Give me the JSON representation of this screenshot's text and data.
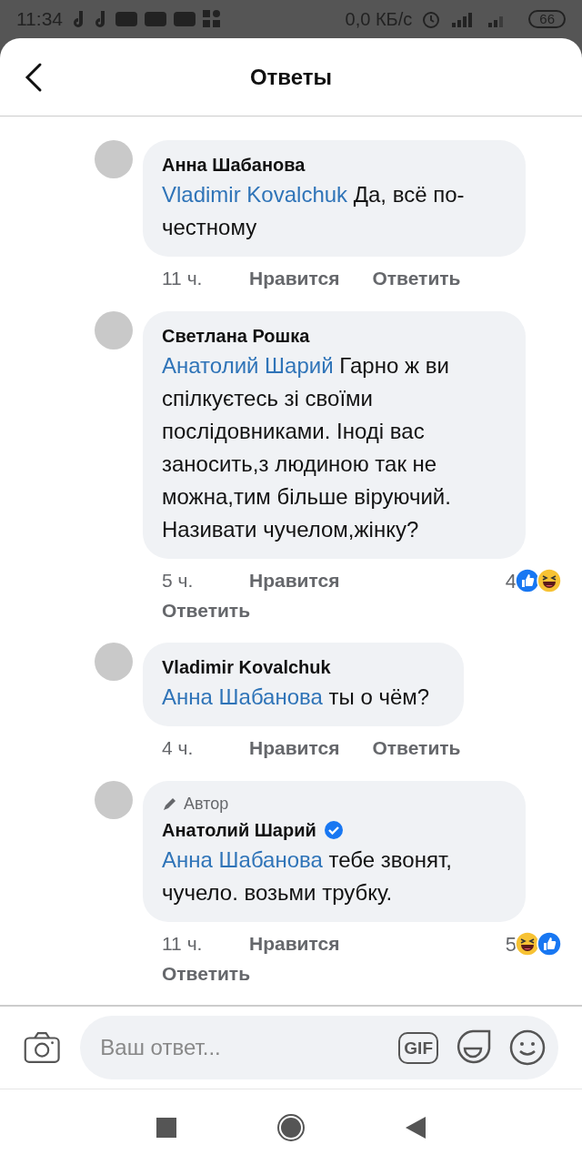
{
  "status_bar": {
    "time": "11:34",
    "speed": "0,0 КБ/с",
    "battery": "66"
  },
  "header": {
    "title": "Ответы"
  },
  "comments": [
    {
      "author": "Анна Шабанова",
      "verified": false,
      "mention": "Vladimir Kovalchuk",
      "text": "Да, всё по-честному",
      "time": "11 ч.",
      "like": "Нравится",
      "reply": "Ответить"
    },
    {
      "author": "Светлана Рошка",
      "verified": false,
      "mention": "Анатолий Шарий",
      "text": "Гарно ж ви спілкуєтесь зі своїми послідовниками. Іноді вас заносить,з людиною так не можна,тим більше віруючий. Називати чучелом,жінку?",
      "time": "5 ч.",
      "like": "Нравится",
      "reply": "Ответить",
      "reactions": {
        "count": "4",
        "icons": [
          {
            "kind": "like"
          },
          {
            "kind": "haha"
          }
        ]
      }
    },
    {
      "author": "Vladimir Kovalchuk",
      "verified": false,
      "mention": "Анна Шабанова",
      "text": "ты о чём?",
      "time": "4 ч.",
      "like": "Нравится",
      "reply": "Ответить"
    },
    {
      "author": "Анатолий Шарий",
      "badge": "Автор",
      "verified": true,
      "mention": "Анна Шабанова",
      "text": "тебе звонят, чучело. возьми трубку.",
      "time": "11 ч.",
      "like": "Нравится",
      "reply": "Ответить",
      "reactions": {
        "count": "5",
        "icons": [
          {
            "kind": "haha"
          },
          {
            "kind": "like"
          }
        ]
      }
    }
  ],
  "composer": {
    "placeholder": "Ваш ответ...",
    "gif_label": "GIF"
  }
}
